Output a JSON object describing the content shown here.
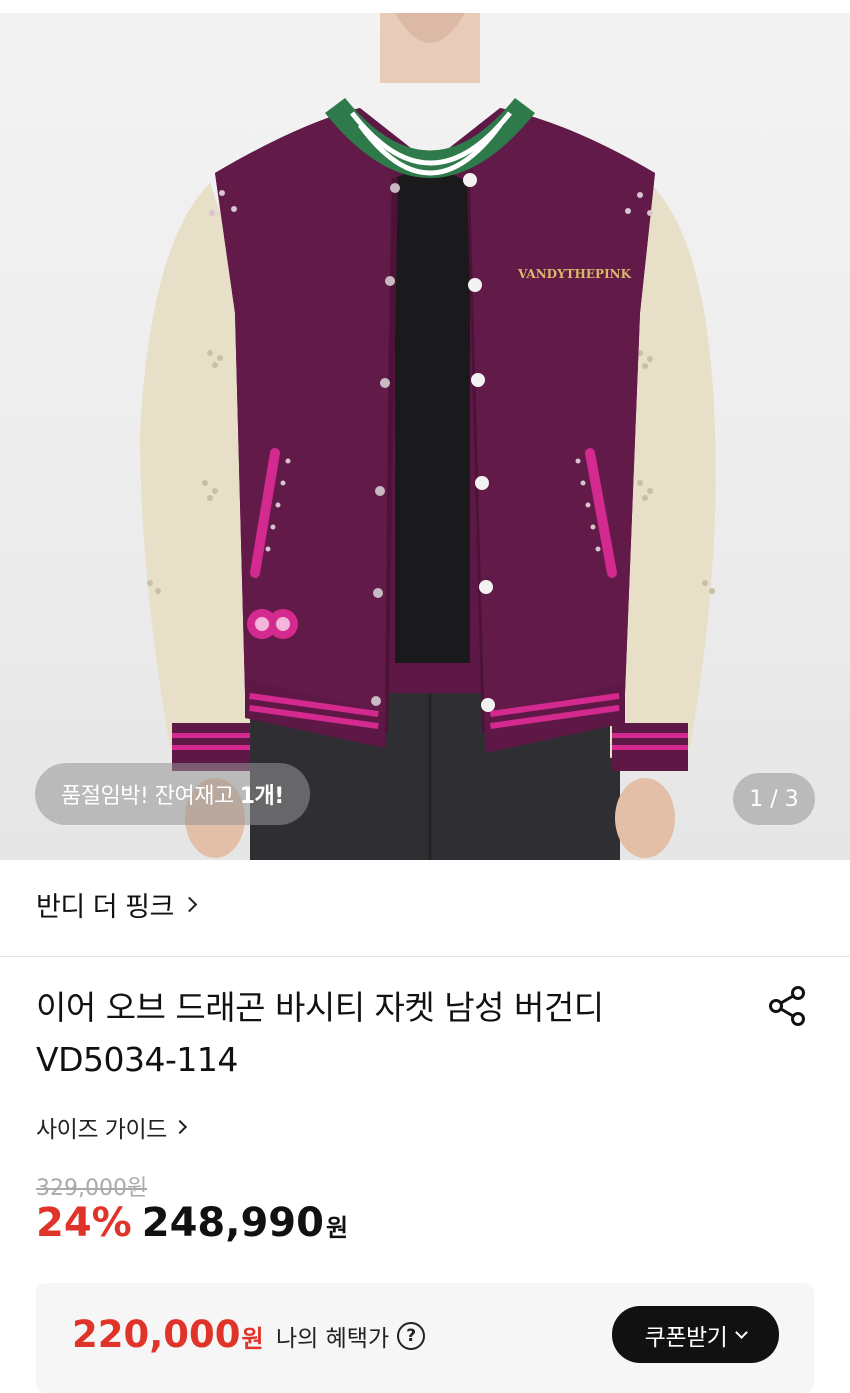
{
  "hero": {
    "stock_notice_prefix": "품절임박! 잔여재고",
    "stock_notice_count": "1개!",
    "image_counter": "1 / 3",
    "jacket_print": "VANDYTHEPINK"
  },
  "brand": {
    "name": "반디 더 핑크"
  },
  "product": {
    "title_line1": "이어 오브 드래곤 바시티 자켓 남성 버건디",
    "title_line2": "VD5034-114",
    "size_guide": "사이즈 가이드"
  },
  "price": {
    "original": "329,000원",
    "discount": "24%",
    "sale": "248,990",
    "sale_unit": "원"
  },
  "benefit": {
    "price": "220,000",
    "unit": "원",
    "label": "나의 혜택가",
    "help": "?",
    "coupon_button": "쿠폰받기"
  },
  "colors": {
    "accent_red": "#e0342a",
    "jacket_body": "#5e1845",
    "sleeve": "#e8dfc8",
    "trim_pink": "#d42a8f",
    "collar_green": "#2f7a4a"
  }
}
